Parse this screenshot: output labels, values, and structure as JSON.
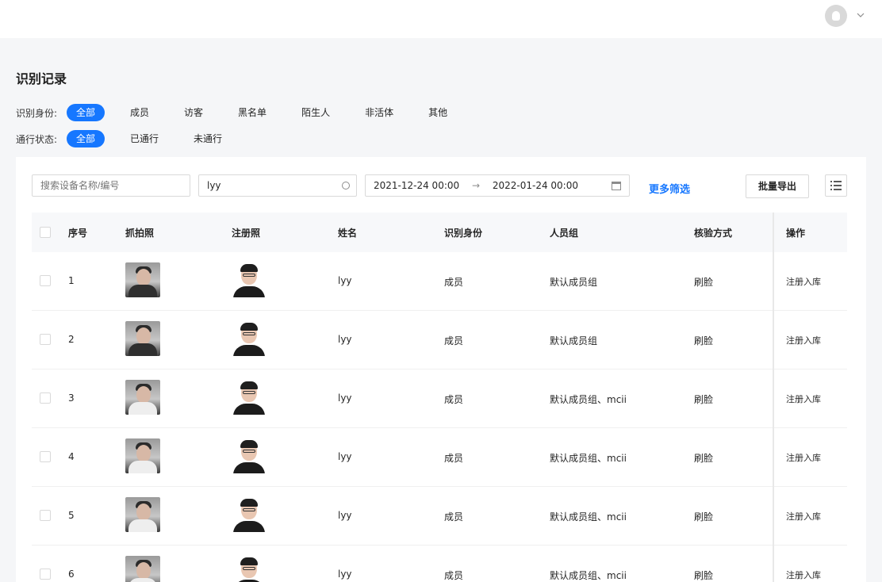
{
  "header": {
    "avatar_icon": "user-avatar-icon",
    "dropdown_icon": "chevron-down-icon"
  },
  "page": {
    "title": "识别记录"
  },
  "filters": {
    "identity": {
      "label": "识别身份:",
      "options": [
        "全部",
        "成员",
        "访客",
        "黑名单",
        "陌生人",
        "非活体",
        "其他"
      ],
      "selected": "全部"
    },
    "status": {
      "label": "通行状态:",
      "options": [
        "全部",
        "已通行",
        "未通行"
      ],
      "selected": "全部"
    }
  },
  "toolbar": {
    "search_placeholder": "搜索设备名称/编号",
    "name_value": "lyy",
    "date_start": "2021-12-24 00:00",
    "date_arrow": "→",
    "date_end": "2022-01-24 00:00",
    "more_filter": "更多筛选",
    "export_label": "批量导出",
    "colors": {
      "accent": "#1677ff",
      "link_faded": "#91b8f5"
    }
  },
  "table": {
    "columns": [
      "序号",
      "抓拍照",
      "注册照",
      "姓名",
      "识别身份",
      "人员组",
      "核验方式",
      "操作"
    ],
    "rows": [
      {
        "index": "1",
        "name": "lyy",
        "identity": "成员",
        "group": "默认成员组",
        "method": "刷脸",
        "action": "注册入库"
      },
      {
        "index": "2",
        "name": "lyy",
        "identity": "成员",
        "group": "默认成员组",
        "method": "刷脸",
        "action": "注册入库"
      },
      {
        "index": "3",
        "name": "lyy",
        "identity": "成员",
        "group": "默认成员组、mcii",
        "method": "刷脸",
        "action": "注册入库"
      },
      {
        "index": "4",
        "name": "lyy",
        "identity": "成员",
        "group": "默认成员组、mcii",
        "method": "刷脸",
        "action": "注册入库"
      },
      {
        "index": "5",
        "name": "lyy",
        "identity": "成员",
        "group": "默认成员组、mcii",
        "method": "刷脸",
        "action": "注册入库"
      },
      {
        "index": "6",
        "name": "lyy",
        "identity": "成员",
        "group": "默认成员组、mcii",
        "method": "刷脸",
        "action": "注册入库"
      }
    ]
  }
}
